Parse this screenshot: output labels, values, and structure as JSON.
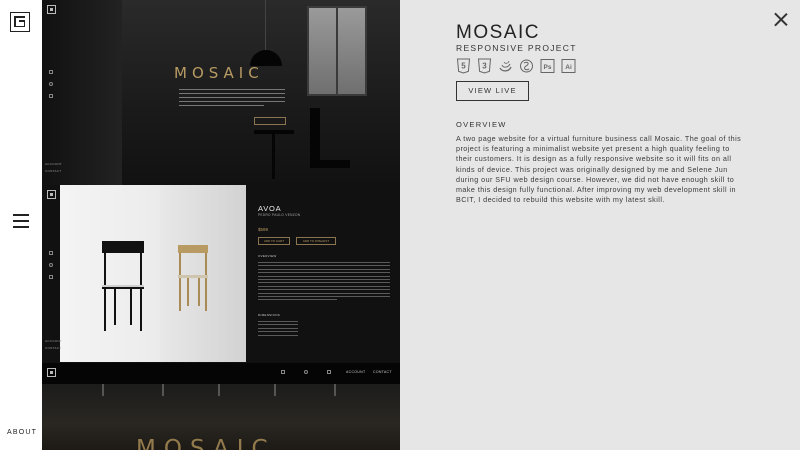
{
  "sidebar": {
    "about_label": "ABOUT"
  },
  "preview": {
    "logo_text": "MOSAIC",
    "logo_text_2": "MOSAIC",
    "product_title": "AVOA",
    "product_subtitle": "PEDRO PAULO VENZON",
    "product_price": "$599",
    "add_to_cart": "ADD TO CART",
    "add_to_wishlist": "ADD TO WISHLIST",
    "overview_small": "OVERVIEW",
    "dimensions_small": "DIMENSIONS",
    "account_label": "ACCOUNT",
    "contact_label": "CONTACT",
    "side_account": "ACCOUNT",
    "side_contact": "CONTACT",
    "brand_color": "#b89b63"
  },
  "project": {
    "title": "MOSAIC",
    "subtitle": "RESPONSIVE PROJECT",
    "tech_icons": [
      "html5-icon",
      "css3-icon",
      "jquery-icon",
      "sass-icon",
      "photoshop-icon",
      "illustrator-icon"
    ],
    "photoshop_abbr": "Ps",
    "illustrator_abbr": "Ai",
    "view_live_label": "VIEW LIVE",
    "overview_heading": "OVERVIEW",
    "overview_text": "A two page website for a virtual furniture business call Mosaic. The goal of this project is featuring a minimalist website yet present a high quality feeling to their customers. It is design as a fully responsive website so it will fits on all kinds of device. This project was originally designed by me and Selene Jun during our SFU web design course. However, we did not have enough skill to make this design fully functional. After improving my web development skill in BCIT, I decided to rebuild this website with my latest skill."
  }
}
